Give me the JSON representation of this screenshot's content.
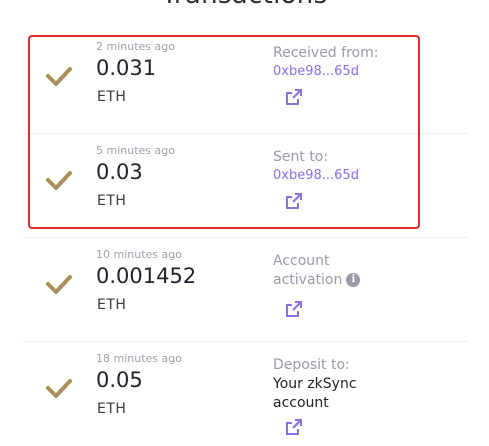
{
  "page": {
    "title": "Transactions"
  },
  "colors": {
    "check": "#a8915a",
    "link": "#8c6fe6",
    "highlight": "#e02b2b"
  },
  "transactions": [
    {
      "time": "2 minutes ago",
      "amount": "0.031",
      "unit": "ETH",
      "label": "Received from:",
      "address": "0xbe98...65d",
      "icon": "external-link-icon"
    },
    {
      "time": "5 minutes ago",
      "amount": "0.03",
      "unit": "ETH",
      "label": "Sent to:",
      "address": "0xbe98...65d",
      "icon": "external-link-icon"
    },
    {
      "time": "10 minutes ago",
      "amount": "0.001452",
      "unit": "ETH",
      "label": "Account activation",
      "info_icon": "info-icon",
      "icon": "external-link-icon"
    },
    {
      "time": "18 minutes ago",
      "amount": "0.05",
      "unit": "ETH",
      "label": "Deposit to: ",
      "label_line2": "Your zkSync account",
      "icon": "external-link-icon"
    }
  ]
}
